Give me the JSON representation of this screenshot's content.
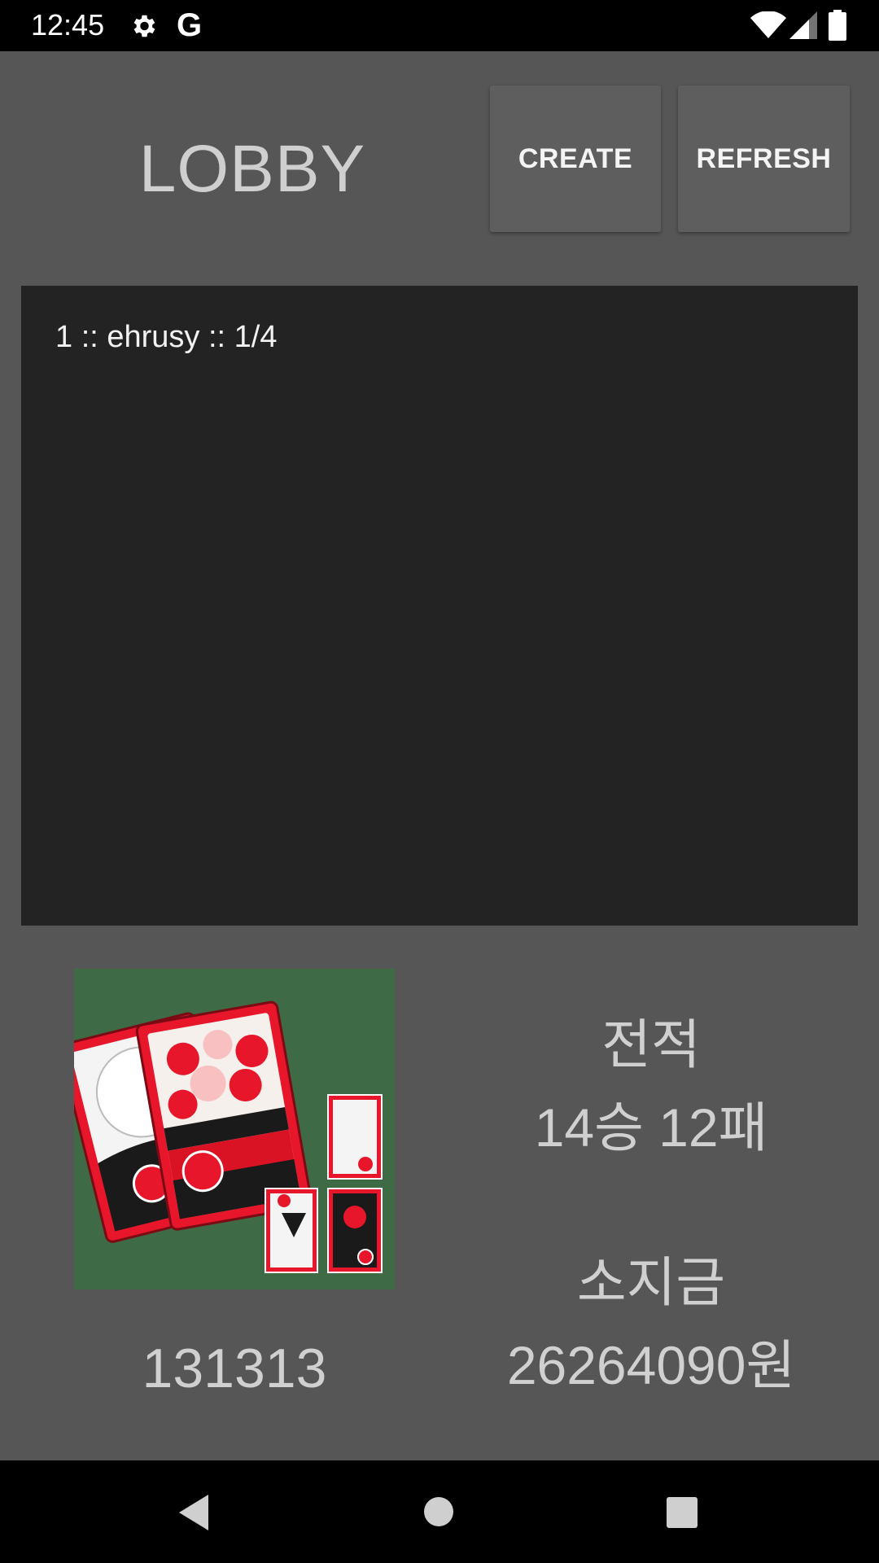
{
  "status_bar": {
    "time": "12:45",
    "g_label": "G",
    "icons": [
      "gear-icon",
      "google-icon",
      "wifi-icon",
      "signal-icon",
      "battery-icon"
    ]
  },
  "lobby": {
    "title": "LOBBY",
    "create_label": "CREATE",
    "refresh_label": "REFRESH"
  },
  "rooms": [
    {
      "label": "1 :: ehrusy :: 1/4"
    }
  ],
  "profile": {
    "user_id": "131313",
    "record_label": "전적",
    "record_value": "14승 12패",
    "money_label": "소지금",
    "money_value": "26264090원"
  },
  "nav_bar": {
    "icons": [
      "back-icon",
      "home-icon",
      "recents-icon"
    ]
  },
  "colors": {
    "background": "#565656",
    "room_list_bg": "#232323",
    "button_bg": "#5e5e5f",
    "card_red": "#e8162a",
    "felt_green": "#3e6b45"
  }
}
